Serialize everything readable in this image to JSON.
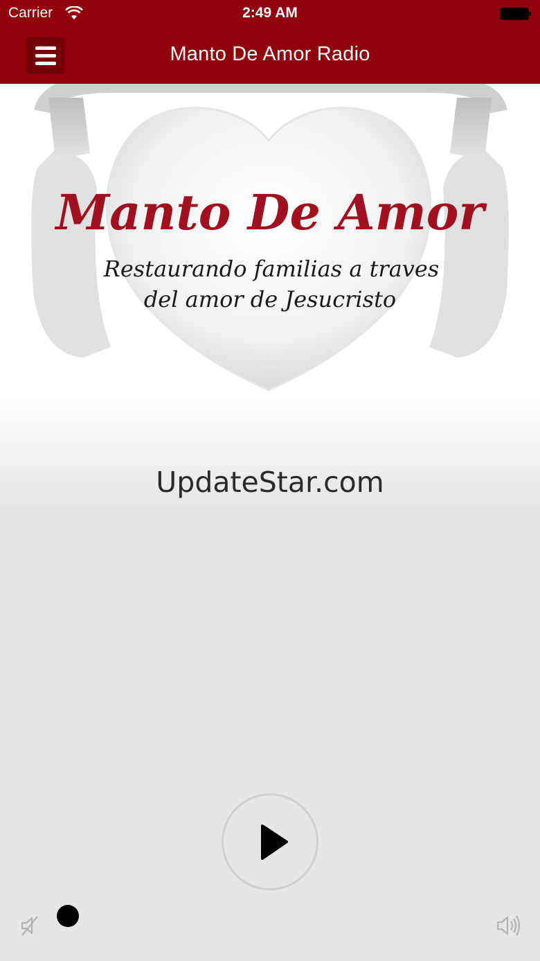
{
  "status_bar": {
    "carrier": "Carrier",
    "time": "2:49 AM",
    "wifi_icon": "wifi-icon",
    "battery_icon": "battery-icon"
  },
  "nav_bar": {
    "title": "Manto De Amor Radio",
    "menu_icon": "hamburger-menu-icon",
    "background_color": "#92000b"
  },
  "artwork": {
    "logo_title": "Manto De Amor",
    "logo_tagline_line1": "Restaurando familias a traves",
    "logo_tagline_line2": "del amor de Jesucristo"
  },
  "player": {
    "stream_title": "UpdateStar.com",
    "play_icon": "play-icon",
    "mute_icon": "volume-mute-icon",
    "volume_icon": "volume-high-icon",
    "volume_level": 0.08
  }
}
